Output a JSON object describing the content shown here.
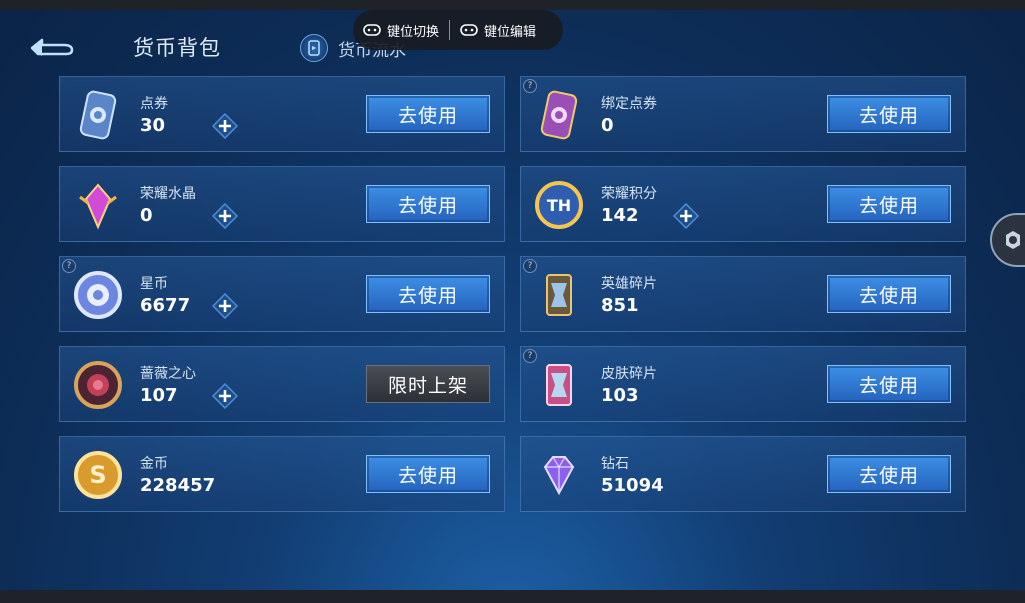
{
  "header": {
    "title": "货币背包",
    "flow_tab": "货币流水"
  },
  "keybind_overlay": {
    "switch_label": "键位切换",
    "edit_label": "键位编辑"
  },
  "colors": {
    "accent_blue": "#2f7ad6",
    "card_border": "#5f96d2",
    "background": "#0d2d57"
  },
  "currencies": [
    {
      "name": "点券",
      "value": "30",
      "icon": "coupon-card-icon",
      "button": "去使用",
      "has_plus": true,
      "has_help": false
    },
    {
      "name": "绑定点券",
      "value": "0",
      "icon": "bound-coupon-card-icon",
      "button": "去使用",
      "has_plus": false,
      "has_help": true
    },
    {
      "name": "荣耀水晶",
      "value": "0",
      "icon": "glory-crystal-icon",
      "button": "去使用",
      "has_plus": true,
      "has_help": false
    },
    {
      "name": "荣耀积分",
      "value": "142",
      "icon": "glory-points-icon",
      "button": "去使用",
      "has_plus": true,
      "has_help": false
    },
    {
      "name": "星币",
      "value": "6677",
      "icon": "star-coin-icon",
      "button": "去使用",
      "has_plus": true,
      "has_help": true
    },
    {
      "name": "英雄碎片",
      "value": "851",
      "icon": "hero-fragment-icon",
      "button": "去使用",
      "has_plus": false,
      "has_help": true
    },
    {
      "name": "蔷薇之心",
      "value": "107",
      "icon": "rose-heart-icon",
      "button": "限时上架",
      "has_plus": true,
      "has_help": false
    },
    {
      "name": "皮肤碎片",
      "value": "103",
      "icon": "skin-fragment-icon",
      "button": "去使用",
      "has_plus": false,
      "has_help": true
    },
    {
      "name": "金币",
      "value": "228457",
      "icon": "gold-coin-icon",
      "button": "去使用",
      "has_plus": false,
      "has_help": false
    },
    {
      "name": "钻石",
      "value": "51094",
      "icon": "diamond-icon",
      "button": "去使用",
      "has_plus": false,
      "has_help": false
    }
  ]
}
